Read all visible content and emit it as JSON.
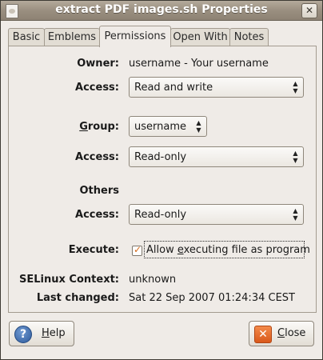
{
  "window": {
    "title": "extract PDF images.sh Properties",
    "close_glyph": "✕"
  },
  "tabs": [
    {
      "label": "Basic"
    },
    {
      "label": "Emblems"
    },
    {
      "label": "Permissions"
    },
    {
      "label": "Open With"
    },
    {
      "label": "Notes"
    }
  ],
  "active_tab": "Permissions",
  "permissions": {
    "owner_label": "Owner:",
    "owner_value": "username - Your username",
    "owner_access_label": "Access:",
    "owner_access_value": "Read and write",
    "group_label_prefix": "",
    "group_label_mnemonic": "G",
    "group_label_rest": "roup:",
    "group_value": "username",
    "group_access_label": "Access:",
    "group_access_value": "Read-only",
    "others_label": "Others",
    "others_access_label": "Access:",
    "others_access_value": "Read-only",
    "execute_label": "Execute:",
    "execute_option_pre": "Allow ",
    "execute_option_mnemonic": "e",
    "execute_option_post": "xecuting file as program",
    "execute_checked": true,
    "selinux_label": "SELinux Context:",
    "selinux_value": "unknown",
    "last_changed_label": "Last changed:",
    "last_changed_value": "Sat 22 Sep 2007 01:24:34 CEST"
  },
  "buttons": {
    "help_mnemonic": "H",
    "help_rest": "elp",
    "close_mnemonic": "C",
    "close_rest": "lose"
  },
  "colors": {
    "checkmark": "#d46a1a",
    "help_icon": "#2e5a9b",
    "close_icon": "#d9581a"
  }
}
